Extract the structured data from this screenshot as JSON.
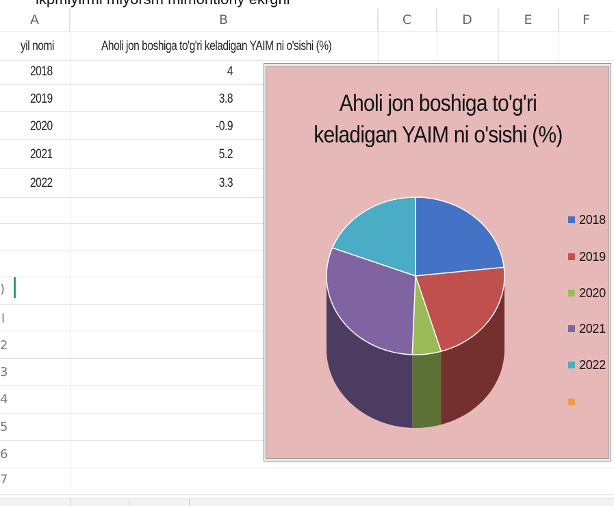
{
  "page_top_fragment": "ikpmiylrmi mlyorsm mimoritloriy ekrgrii",
  "sheet": {
    "columns": [
      "A",
      "B",
      "C",
      "D",
      "E",
      "F"
    ],
    "header_row": {
      "a": "yil nomi",
      "b": "Aholi jon boshiga to'g'ri keladigan YAIM ni o'sishi (%)"
    },
    "rows": [
      {
        "year": "2018",
        "value": "4"
      },
      {
        "year": "2019",
        "value": "3.8"
      },
      {
        "year": "2020",
        "value": "-0.9"
      },
      {
        "year": "2021",
        "value": "5.2"
      },
      {
        "year": "2022",
        "value": "3.3"
      }
    ],
    "row_numbers_visible": [
      ")",
      "l",
      "2",
      "3",
      "4",
      "5",
      "6",
      "7"
    ]
  },
  "colors": {
    "s2018": "#4472c4",
    "s2019": "#c0504d",
    "s2020": "#9bbb59",
    "s2021": "#8064a2",
    "s2022": "#4bacc6",
    "s_extra": "#f79646",
    "chart_bg": "#e6b8b7"
  },
  "chart_data": {
    "type": "pie",
    "title": "Aholi jon boshiga to'g'ri keladigan YAIM ni o'sishi (%)",
    "categories": [
      "2018",
      "2019",
      "2020",
      "2021",
      "2022",
      ""
    ],
    "values": [
      4,
      3.8,
      0.9,
      5.2,
      3.3,
      0
    ],
    "note_3d": true,
    "legend_position": "right"
  }
}
